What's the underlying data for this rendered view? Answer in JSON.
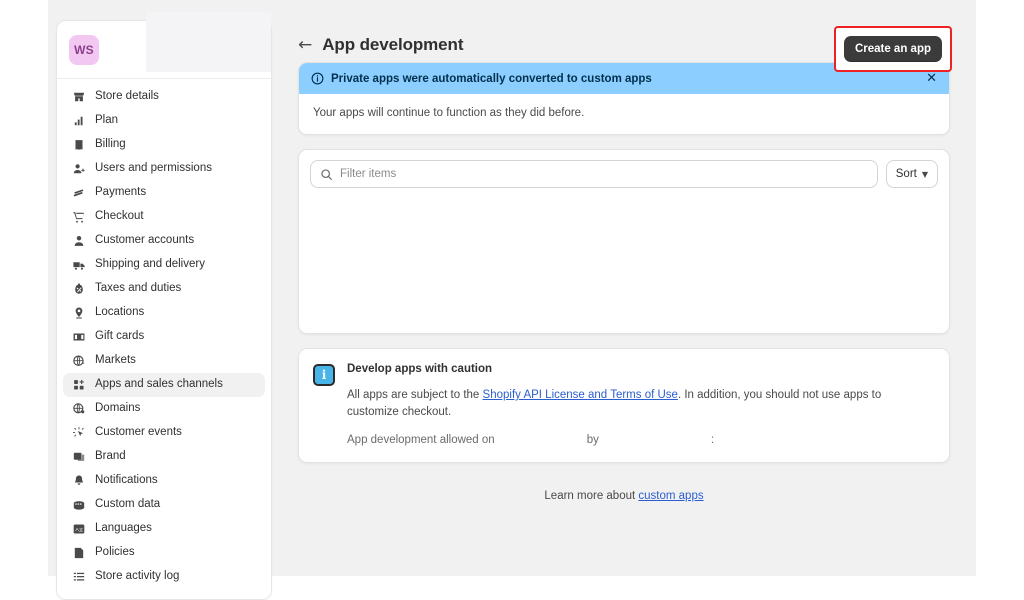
{
  "store": {
    "avatar_initials": "WS"
  },
  "sidebar": {
    "items": [
      {
        "label": "Store details",
        "icon": "store-icon",
        "active": false
      },
      {
        "label": "Plan",
        "icon": "chart-bar-icon",
        "active": false
      },
      {
        "label": "Billing",
        "icon": "receipt-icon",
        "active": false
      },
      {
        "label": "Users and permissions",
        "icon": "user-add-icon",
        "active": false
      },
      {
        "label": "Payments",
        "icon": "credit-card-icon",
        "active": false
      },
      {
        "label": "Checkout",
        "icon": "cart-icon",
        "active": false
      },
      {
        "label": "Customer accounts",
        "icon": "person-icon",
        "active": false
      },
      {
        "label": "Shipping and delivery",
        "icon": "truck-icon",
        "active": false
      },
      {
        "label": "Taxes and duties",
        "icon": "tax-icon",
        "active": false
      },
      {
        "label": "Locations",
        "icon": "pin-icon",
        "active": false
      },
      {
        "label": "Gift cards",
        "icon": "gift-card-icon",
        "active": false
      },
      {
        "label": "Markets",
        "icon": "globe-icon",
        "active": false
      },
      {
        "label": "Apps and sales channels",
        "icon": "apps-grid-icon",
        "active": true
      },
      {
        "label": "Domains",
        "icon": "domain-globe-icon",
        "active": false
      },
      {
        "label": "Customer events",
        "icon": "cursor-click-icon",
        "active": false
      },
      {
        "label": "Brand",
        "icon": "image-icon",
        "active": false
      },
      {
        "label": "Notifications",
        "icon": "bell-icon",
        "active": false
      },
      {
        "label": "Custom data",
        "icon": "database-icon",
        "active": false
      },
      {
        "label": "Languages",
        "icon": "translate-icon",
        "active": false
      },
      {
        "label": "Policies",
        "icon": "policy-icon",
        "active": false
      },
      {
        "label": "Store activity log",
        "icon": "list-icon",
        "active": false
      }
    ]
  },
  "header": {
    "back_icon": "arrow-left-icon",
    "title": "App development",
    "create_app_label": "Create an app"
  },
  "banner": {
    "info_icon": "info-circle-icon",
    "title": "Private apps were automatically converted to custom apps",
    "close_icon": "close-icon",
    "body": "Your apps will continue to function as they did before."
  },
  "list": {
    "search_icon": "search-icon",
    "filter_placeholder": "Filter items",
    "filter_value": "",
    "sort_label": "Sort",
    "sort_chevron_icon": "chevron-down-icon"
  },
  "caution": {
    "icon": "info-badge-icon",
    "title": "Develop apps with caution",
    "text_before_link": "All apps are subject to the ",
    "link_label": "Shopify API License and Terms of Use",
    "text_after_link": ". In addition, you should not use apps to customize checkout.",
    "allowed_prefix": "App development allowed on",
    "allowed_by": "by",
    "allowed_colon": ":"
  },
  "footer": {
    "text": "Learn more about ",
    "link_label": "custom apps"
  },
  "colors": {
    "page_background": "#f1f1f1",
    "banner_header": "#8cceff",
    "accent_button": "#3b3b3b",
    "highlight_outline": "#ee2222",
    "link": "#2c5ecf",
    "avatar_background": "#f2c8f2"
  }
}
